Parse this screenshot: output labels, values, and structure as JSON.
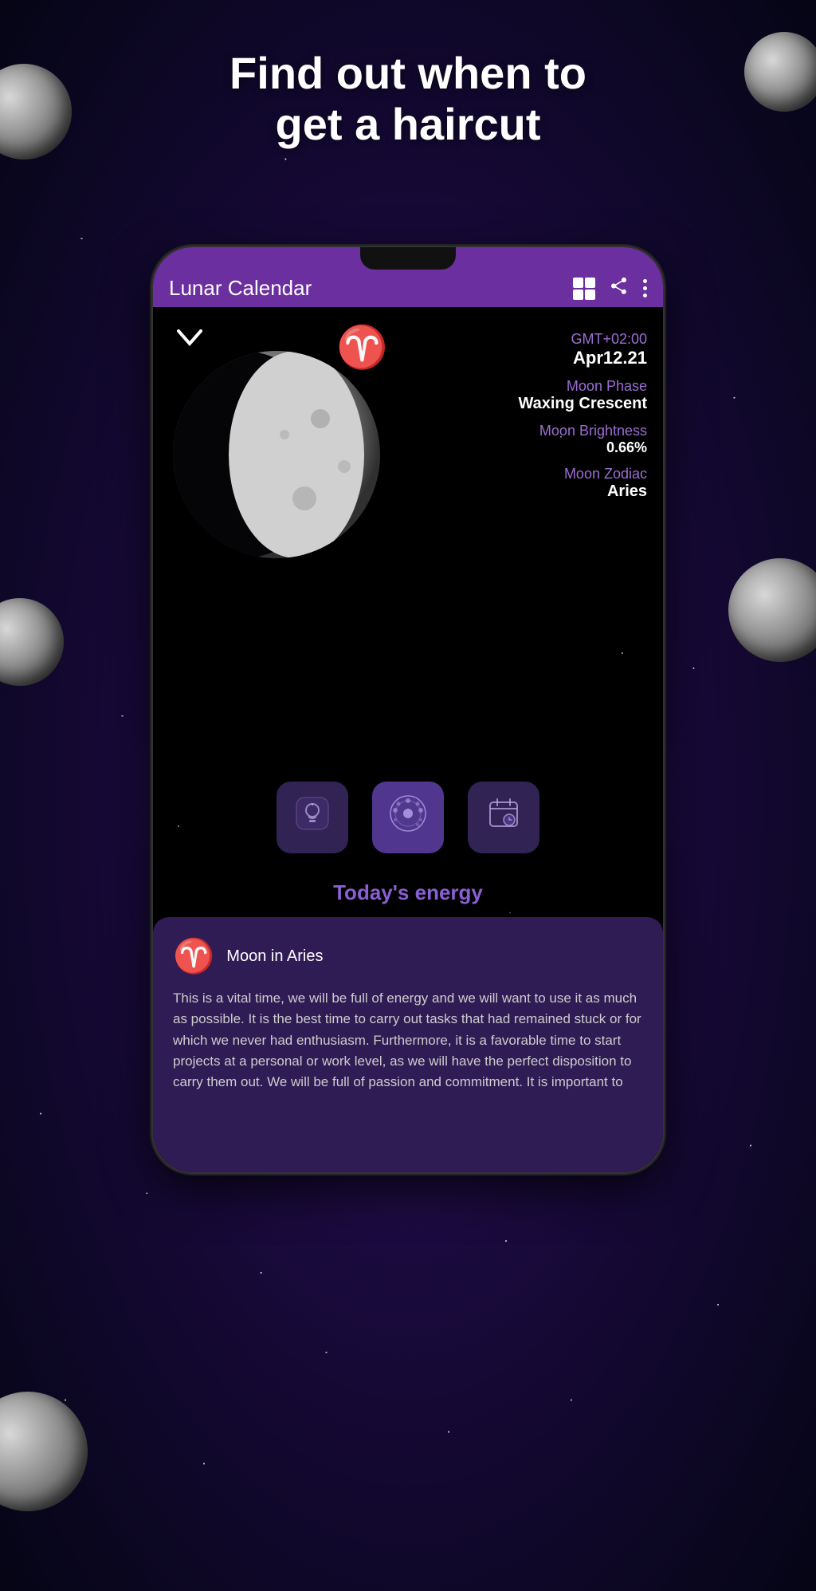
{
  "header": {
    "title": "Find out when to\nget a haircut"
  },
  "app_bar": {
    "title": "Lunar Calendar",
    "icons": {
      "grid": "grid-icon",
      "share": "share-icon",
      "more": "more-icon"
    }
  },
  "moon_info": {
    "timezone": "GMT+02:00",
    "date": "Apr12.21",
    "phase_label": "Moon Phase",
    "phase_value": "Waxing Crescent",
    "brightness_label": "Moon Brightness",
    "brightness_value": "0.66%",
    "zodiac_label": "Moon Zodiac",
    "zodiac_value": "Aries",
    "zodiac_symbol": "♈"
  },
  "chevron": "❯",
  "buttons": [
    {
      "id": "info",
      "icon": "💡",
      "label": "info-button"
    },
    {
      "id": "moon",
      "icon": "🌑",
      "label": "moon-button",
      "active": true
    },
    {
      "id": "calendar",
      "icon": "📅",
      "label": "calendar-button"
    }
  ],
  "energy_section": {
    "title": "Today's energy",
    "card": {
      "zodiac_symbol": "♈",
      "subtitle": "Moon in Aries",
      "body": "This is a vital time, we will be full of energy and we will want to use it as much as possible. It is the best time to carry out tasks that had remained stuck or for which we never had enthusiasm. Furthermore, it is a favorable time to start projects at a personal or work level, as we will have the perfect disposition to carry them out. We will be full of passion and commitment. It is important to"
    }
  }
}
